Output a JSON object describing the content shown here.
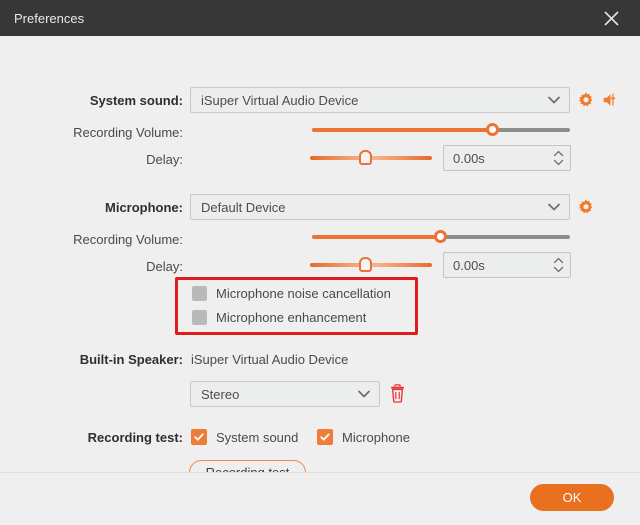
{
  "window": {
    "title": "Preferences",
    "close_icon": "close-icon",
    "titlebar_color": "#373737",
    "background_color": "#efefef",
    "accent_color": "#e8701f",
    "highlight_color": "#e01b1b"
  },
  "system_sound": {
    "label": "System sound:",
    "device": "iSuper Virtual Audio Device",
    "chevron_icon": "chevron-down-icon",
    "settings_icon": "gear-icon",
    "speaker_icon": "speaker-volume-icon",
    "volume": {
      "label": "Recording Volume:",
      "value_percent": 70
    },
    "delay": {
      "label": "Delay:",
      "value": "0.00s",
      "value_percent": 45,
      "stepper_up_icon": "chevron-up-icon",
      "stepper_down_icon": "chevron-down-icon"
    }
  },
  "microphone": {
    "label": "Microphone:",
    "device": "Default Device",
    "chevron_icon": "chevron-down-icon",
    "settings_icon": "gear-icon",
    "volume": {
      "label": "Recording Volume:",
      "value_percent": 50
    },
    "delay": {
      "label": "Delay:",
      "value": "0.00s",
      "value_percent": 45,
      "stepper_up_icon": "chevron-up-icon",
      "stepper_down_icon": "chevron-down-icon"
    },
    "options": [
      {
        "label": "Microphone noise cancellation",
        "checked": false,
        "enabled": false
      },
      {
        "label": "Microphone enhancement",
        "checked": false,
        "enabled": false
      }
    ]
  },
  "built_in_speaker": {
    "label": "Built-in Speaker:",
    "device": "iSuper Virtual Audio Device",
    "channel": "Stereo",
    "chevron_icon": "chevron-down-icon",
    "delete_icon": "trash-icon"
  },
  "recording_test": {
    "label": "Recording test:",
    "options": [
      {
        "label": "System sound",
        "checked": true
      },
      {
        "label": "Microphone",
        "checked": true
      }
    ],
    "button_label": "Recording test",
    "check_icon": "check-icon"
  },
  "footer": {
    "ok_label": "OK"
  }
}
